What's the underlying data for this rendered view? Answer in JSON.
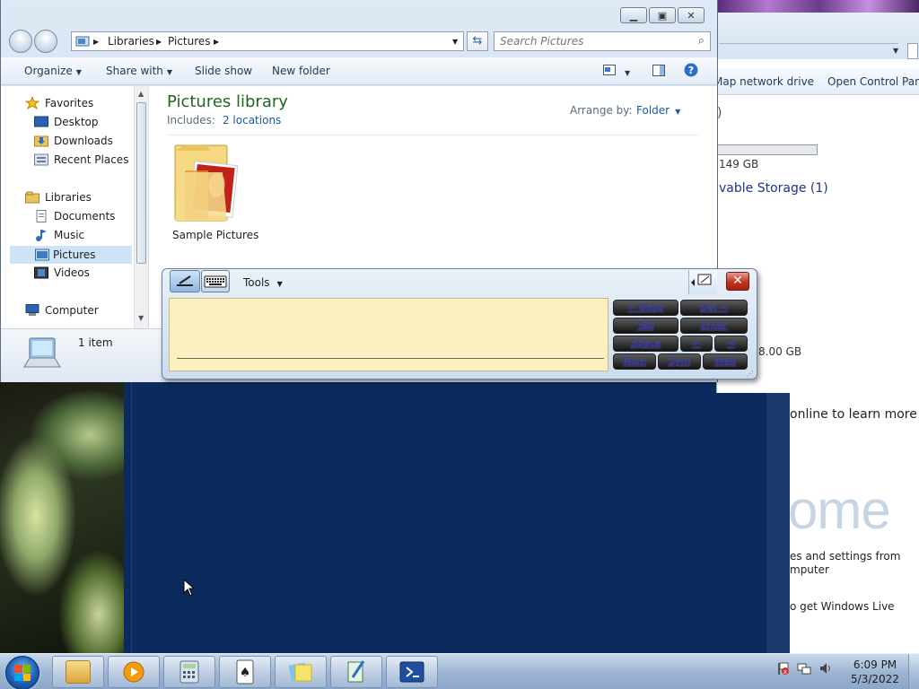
{
  "explorer": {
    "address": [
      "Libraries",
      "Pictures"
    ],
    "search_placeholder": "Search Pictures",
    "toolbar": {
      "organize": "Organize",
      "share_with": "Share with",
      "slide_show": "Slide show",
      "new_folder": "New folder"
    },
    "nav": {
      "favorites": "Favorites",
      "desktop": "Desktop",
      "downloads": "Downloads",
      "recent_places": "Recent Places",
      "libraries": "Libraries",
      "documents": "Documents",
      "music": "Music",
      "pictures": "Pictures",
      "videos": "Videos",
      "computer": "Computer"
    },
    "library_title": "Pictures library",
    "includes_label": "Includes:",
    "includes_link": "2 locations",
    "arrange_label": "Arrange by:",
    "arrange_value": "Folder",
    "folder_name": "Sample Pictures",
    "item_count": "1 item"
  },
  "computer_window": {
    "map_network_drive": "Map network drive",
    "open_control_panel": "Open Control Panel",
    "paren": ")",
    "disk_size": "149 GB",
    "removable_storage": "vable Storage (1)",
    "other_size": "8.00 GB"
  },
  "welcome": {
    "online_text": "online to learn more",
    "big_text": "ome",
    "files_text_1": "es and settings from",
    "files_text_2": "mputer",
    "live_text": "o get Windows Live"
  },
  "input_panel": {
    "tools_label": "Tools",
    "keys": {
      "bksp": "← Bksp",
      "del": "Del →",
      "tab": "Tab",
      "enter": "Enter",
      "space": "Space",
      "left": "←",
      "right": "→",
      "num": "Num",
      "sym": "Sym",
      "web": "Web"
    }
  },
  "taskbar": {
    "time": "6:09 PM",
    "date": "5/3/2022"
  },
  "colors": {
    "library_title": "#226622",
    "link": "#1b5aa8",
    "writing_pad": "#fbf0bf",
    "desktop_blue": "#0b2a5e"
  }
}
